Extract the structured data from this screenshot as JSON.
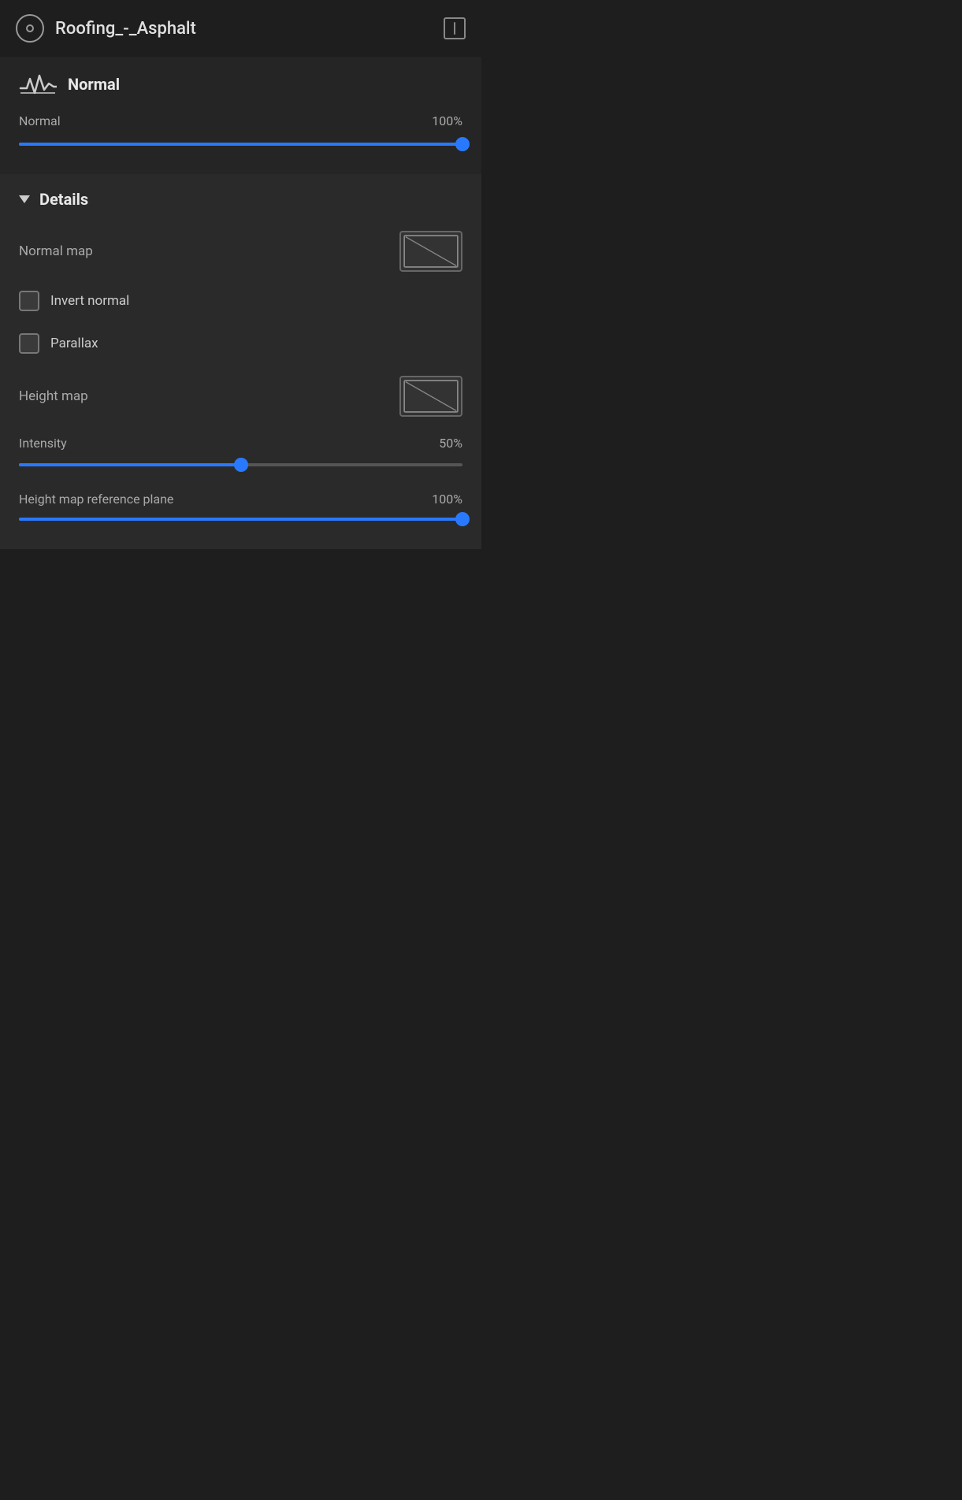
{
  "titleBar": {
    "title": "Roofing_-_Asphalt",
    "panelIconLabel": "panel"
  },
  "normalSection": {
    "sectionTitle": "Normal",
    "sliderLabel": "Normal",
    "sliderValue": "100%",
    "sliderPercent": 100
  },
  "detailsSection": {
    "sectionTitle": "Details",
    "normalMapLabel": "Normal map",
    "invertNormalLabel": "Invert normal",
    "parallaxLabel": "Parallax",
    "heightMapLabel": "Height map",
    "intensityLabel": "Intensity",
    "intensityValue": "50%",
    "intensityPercent": 50,
    "refPlaneLabel": "Height map reference plane",
    "refPlaneValue": "100%"
  }
}
